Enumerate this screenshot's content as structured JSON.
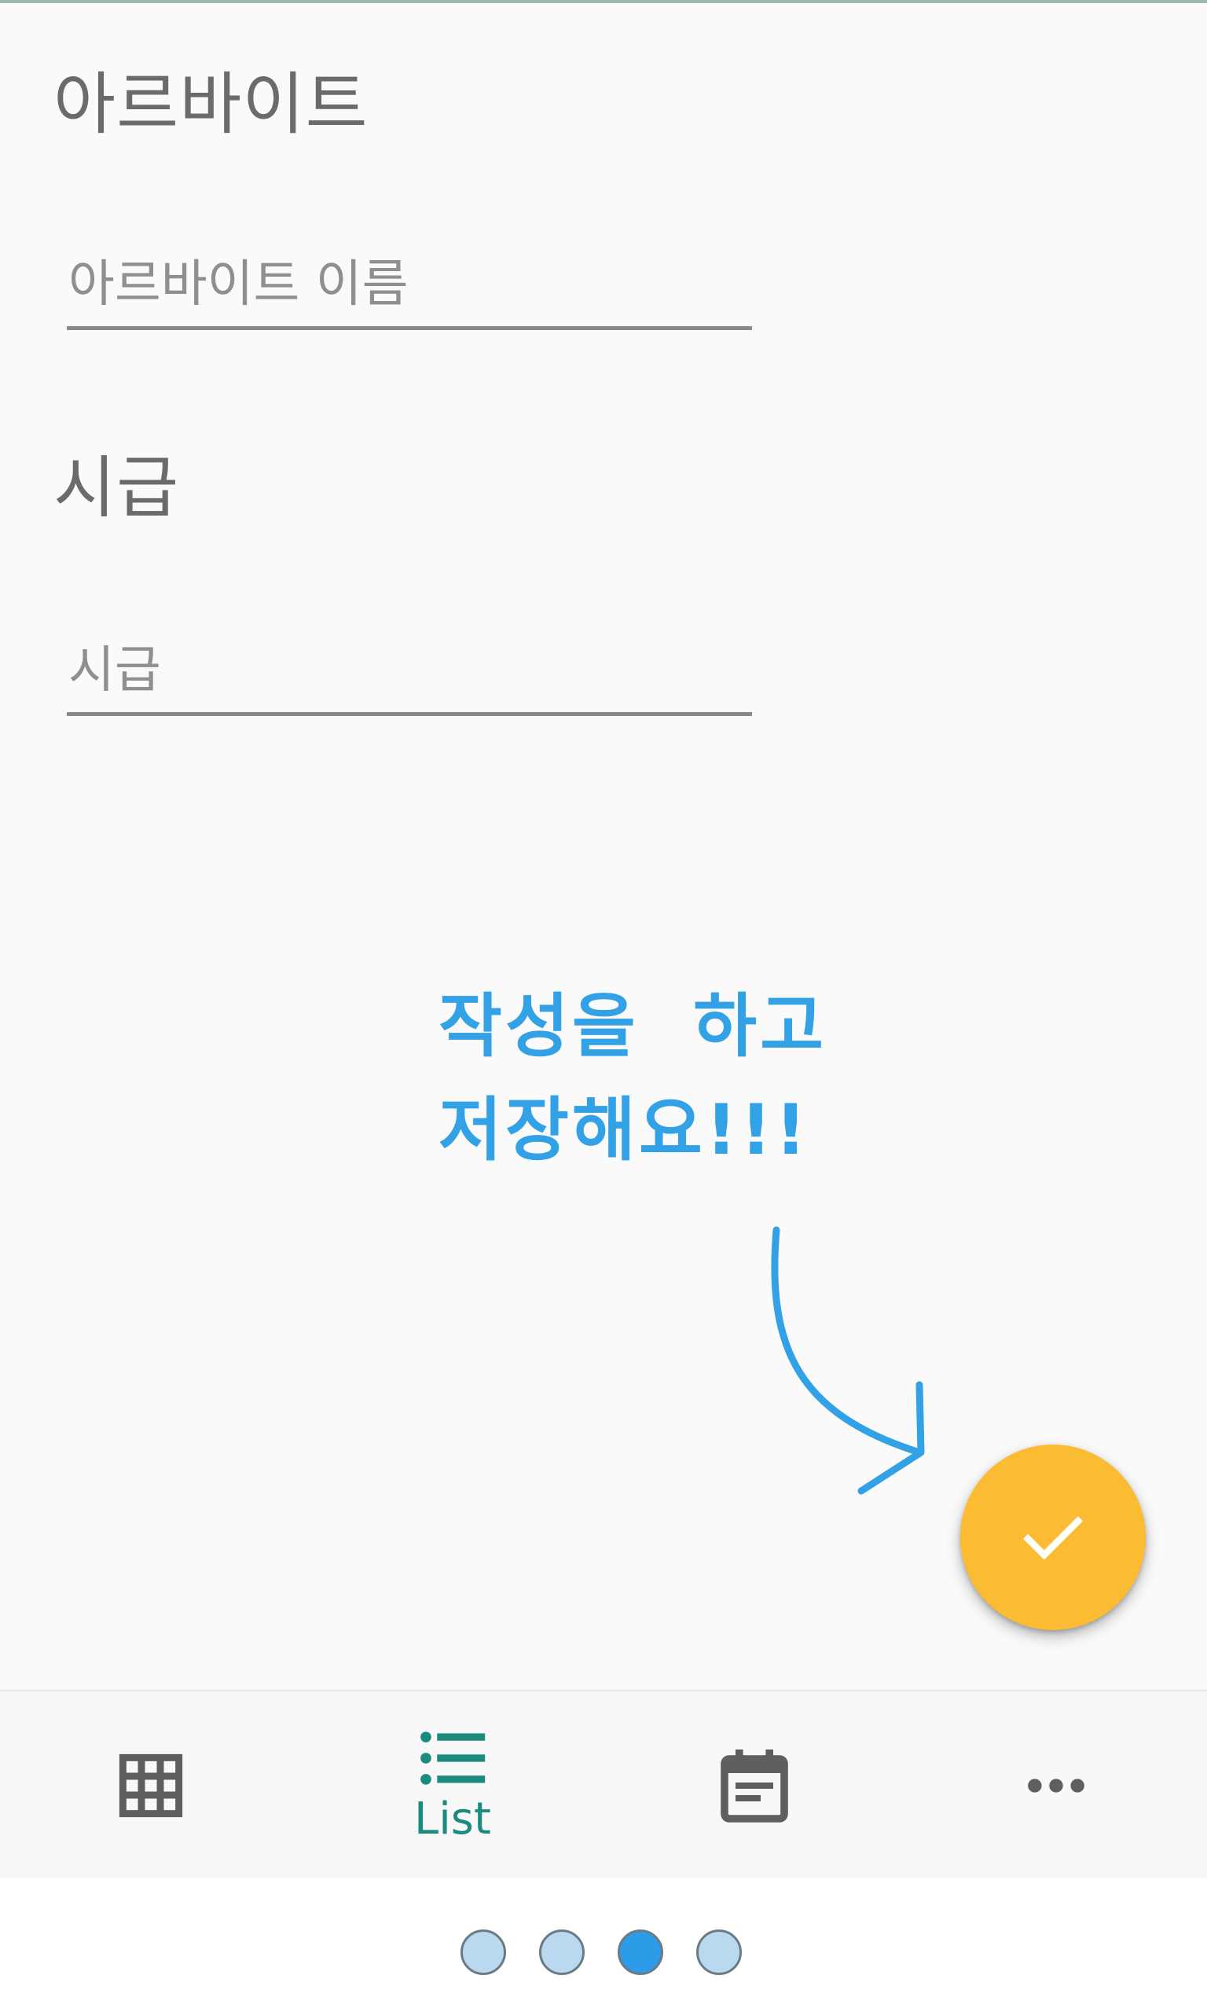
{
  "form": {
    "job_label": "아르바이트",
    "job_placeholder": "아르바이트 이름",
    "wage_label": "시급",
    "wage_placeholder": "시급"
  },
  "annotation": {
    "line1": "작성을  하고",
    "line2": "저장해요!!!"
  },
  "fab": {
    "icon": "check-icon"
  },
  "bottom_nav": {
    "items": [
      {
        "icon": "grid-icon",
        "label": "",
        "active": false
      },
      {
        "icon": "list-icon",
        "label": "List",
        "active": true
      },
      {
        "icon": "calendar-icon",
        "label": "",
        "active": false
      },
      {
        "icon": "more-icon",
        "label": "",
        "active": false
      }
    ]
  },
  "pager": {
    "total": 4,
    "current": 3
  },
  "colors": {
    "accent": "#1b8b7f",
    "fab": "#fbbc33",
    "annotation": "#32a1e6",
    "icon_gray": "#5f5f5f"
  }
}
